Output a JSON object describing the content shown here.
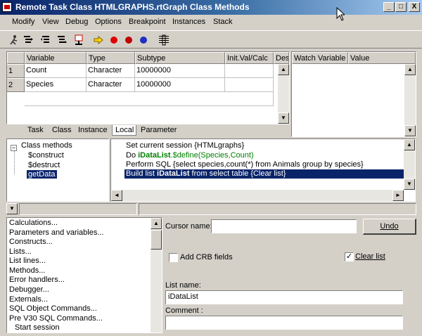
{
  "window": {
    "title": "Remote Task Class HTMLGRAPHS.rtGraph Class Methods",
    "controls": [
      "_",
      "□",
      "X"
    ]
  },
  "menu": [
    "Modify",
    "View",
    "Debug",
    "Options",
    "Breakpoint",
    "Instances",
    "Stack"
  ],
  "toolbar": {
    "icons": [
      "run-icon",
      "step-into-icon",
      "step-over-icon",
      "step-out-icon",
      "trace-icon",
      "go-point-icon",
      "breakpoint-icon",
      "stop-icon",
      "record-icon",
      "format-icon"
    ]
  },
  "variables": {
    "columns": [
      "Variable",
      "Type",
      "Subtype",
      "Init.Val/Calc",
      "Des"
    ],
    "rows": [
      {
        "num": "1",
        "variable": "Count",
        "type": "Character",
        "subtype": "10000000"
      },
      {
        "num": "2",
        "variable": "Species",
        "type": "Character",
        "subtype": "10000000"
      }
    ],
    "tabs": [
      "Task",
      "Class",
      "Instance",
      "Local",
      "Parameter"
    ],
    "active_tab": "Local"
  },
  "watch": {
    "columns": [
      "Watch Variable",
      "Value"
    ]
  },
  "methods_tree": {
    "root": "Class methods",
    "items": [
      "$construct",
      "$destruct",
      "getData"
    ],
    "selected": "getData"
  },
  "code": {
    "lines": [
      {
        "prefix": "Set current session {HTMLgraphs}",
        "bold": "",
        "green": "",
        "suffix": ""
      },
      {
        "prefix": "Do ",
        "bold": "iDataList",
        "green": ".$define(Species,Count)",
        "suffix": ""
      },
      {
        "prefix": "Perform SQL {select species,count(*) from Animals group by species}",
        "bold": "",
        "green": "",
        "suffix": ""
      },
      {
        "prefix": "Build list ",
        "bold": "iDataList",
        "green": "",
        "suffix": " from select table  {Clear list}"
      }
    ],
    "selected_line": 3
  },
  "commands": {
    "items": [
      "Calculations...",
      "Parameters and variables...",
      "Constructs...",
      "Lists...",
      "List lines...",
      "Methods...",
      "Error handlers...",
      "Debugger...",
      "Externals...",
      "SQL Object Commands...",
      "Pre V30 SQL Commands..."
    ],
    "sub_item": "Start session"
  },
  "params": {
    "cursor_label": "Cursor name:",
    "cursor_value": "",
    "undo_label": "Undo",
    "add_crb_label": "Add CRB fields",
    "add_crb_checked": false,
    "clear_list_label": "Clear list",
    "clear_list_checked": true,
    "list_name_label": "List name:",
    "list_name_value": "iDataList",
    "comment_label": "Comment :",
    "comment_value": ""
  }
}
